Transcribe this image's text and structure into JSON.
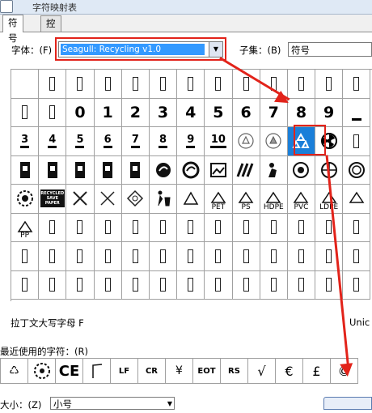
{
  "window": {
    "title": "字符映射表"
  },
  "tabs": [
    {
      "label": "符号"
    },
    {
      "label": "控制符"
    }
  ],
  "font": {
    "label": "字体：",
    "hotkey": "(F)",
    "value": "Seagull: Recycling v1.0"
  },
  "subset": {
    "label": "子集：",
    "hotkey": "(B)",
    "value": "符号"
  },
  "grid": {
    "row2": [
      "0",
      "1",
      "2",
      "3",
      "4",
      "5",
      "6",
      "7",
      "8",
      "9"
    ],
    "row3": [
      "3",
      "4",
      "5",
      "6",
      "7",
      "8",
      "9",
      "10"
    ],
    "codes": [
      "PET",
      "PS",
      "HDPE",
      "PVC",
      "LDPE",
      "PP"
    ],
    "banner": "RECYCLED SAVE PAPER"
  },
  "description": "拉丁文大写字母 F",
  "unicode_label": "Unic",
  "recent": {
    "label": "最近使用的字符：",
    "hotkey": "(R)",
    "items": [
      "♺",
      "CE",
      "LF",
      "CR",
      "¥",
      "EOT",
      "RS",
      "√",
      "€",
      "£",
      "©"
    ]
  },
  "size": {
    "label": "大小：",
    "hotkey": "(Z)",
    "value": "小号"
  }
}
